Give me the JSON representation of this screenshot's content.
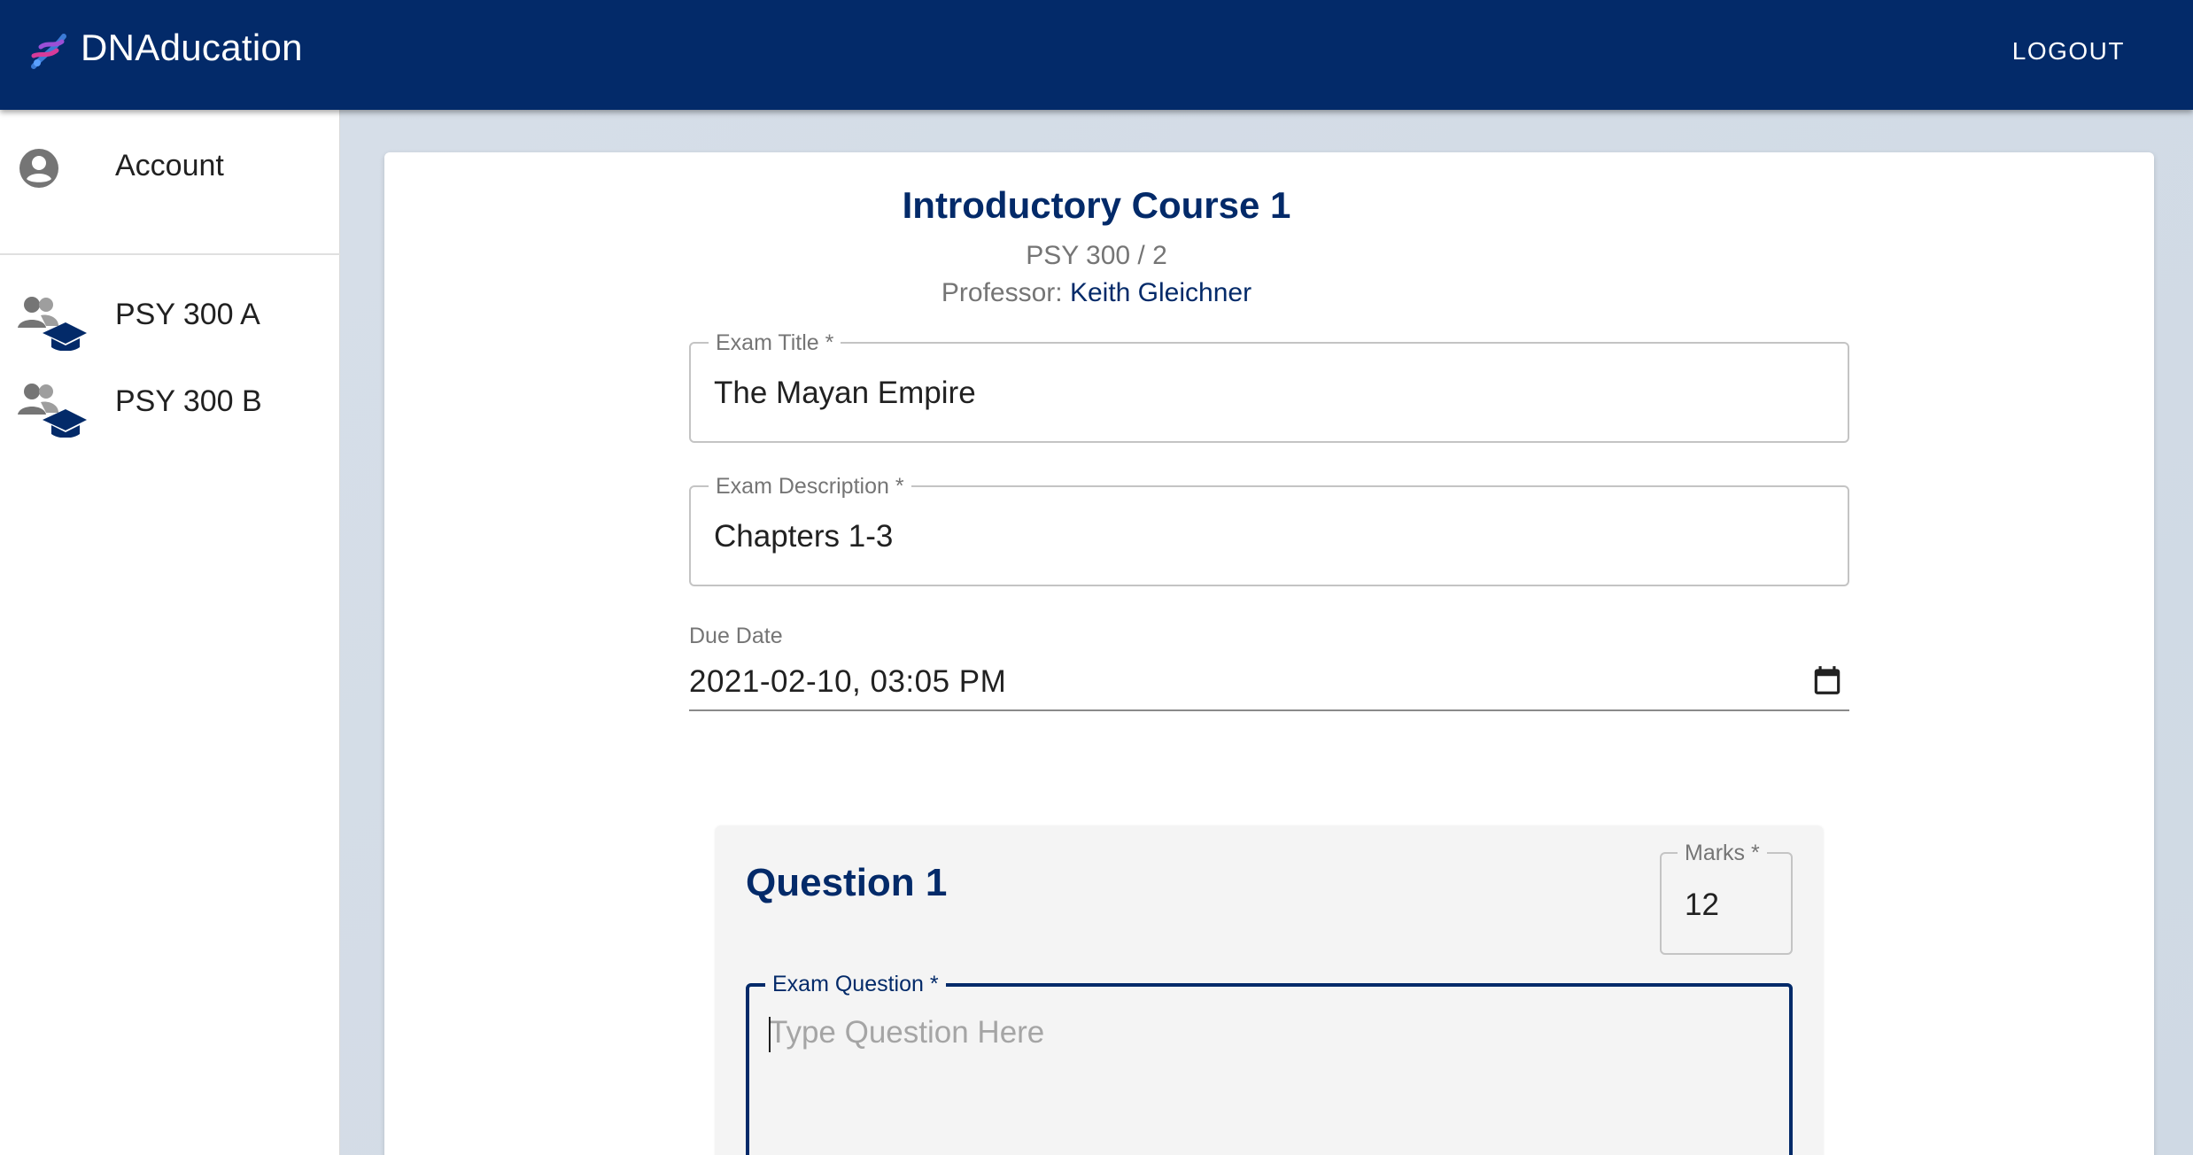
{
  "app": {
    "brand": "DNAducation",
    "logout_label": "LOGOUT",
    "primary_color": "#032a69"
  },
  "sidebar": {
    "items": [
      {
        "label": "Account",
        "icon": "account-circle-icon"
      },
      {
        "label": "PSY 300 A",
        "icon": "class-group-icon"
      },
      {
        "label": "PSY 300 B",
        "icon": "class-group-icon"
      }
    ]
  },
  "course": {
    "title": "Introductory Course 1",
    "code": "PSY 300 / 2",
    "professor_label": "Professor:",
    "professor_name": "Keith Gleichner"
  },
  "form": {
    "exam_title": {
      "label": "Exam Title *",
      "value": "The Mayan Empire"
    },
    "exam_description": {
      "label": "Exam Description *",
      "value": "Chapters 1-3"
    },
    "due_date": {
      "label": "Due Date",
      "value": "2021-02-10, 03:05 PM",
      "icon": "calendar-icon"
    }
  },
  "question": {
    "title": "Question 1",
    "marks_label": "Marks *",
    "marks_value": "12",
    "question_label": "Exam Question *",
    "question_placeholder": "Type Question Here",
    "question_value": ""
  }
}
